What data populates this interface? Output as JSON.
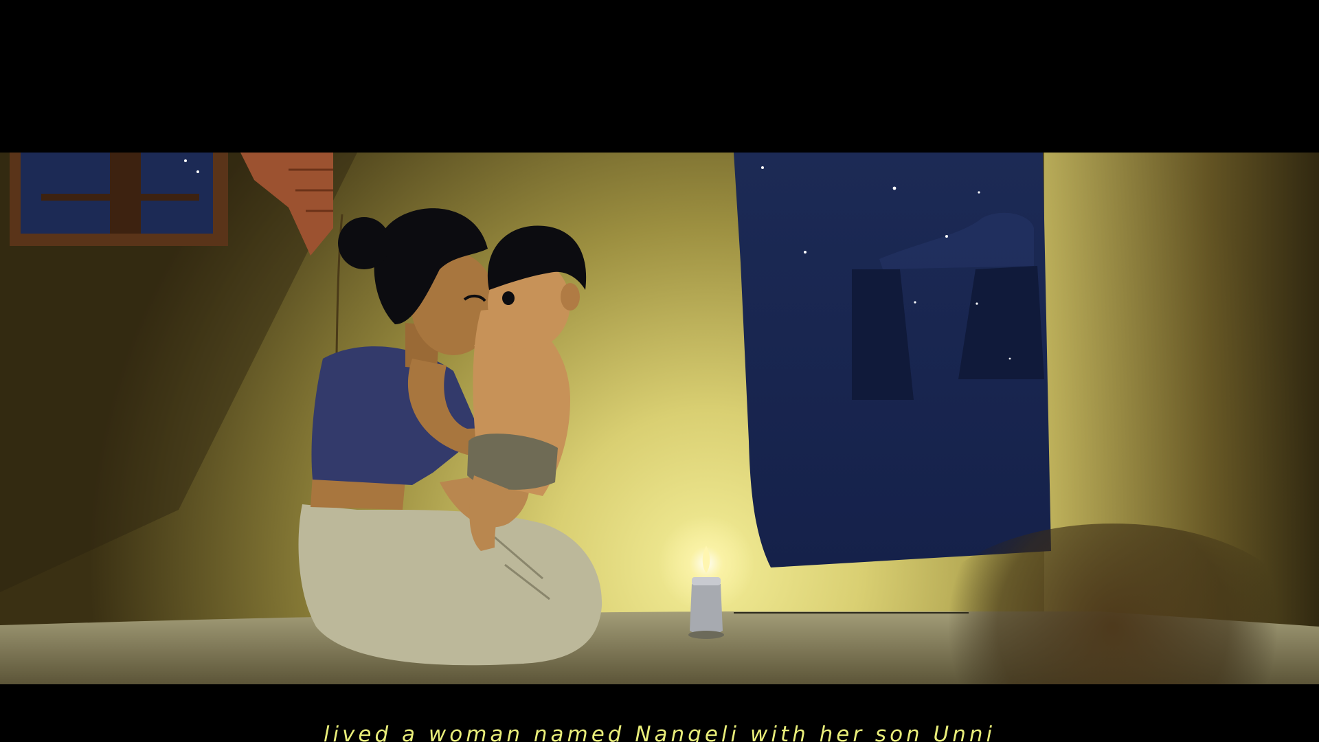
{
  "video": {
    "subtitle": "lived a woman named Nangeli with her son Unni"
  },
  "colors": {
    "letterbox": "#000000",
    "subtitle": "#e9ee7a",
    "wall_glow": "#e8e27a",
    "wall_shadow": "#3d3314",
    "night_sky": "#1c2a55",
    "floor": "#8a8466",
    "blouse": "#333a6b",
    "mundu": "#bcb89a",
    "skin": "#b9874f",
    "hair": "#0c0c10",
    "lamp_flame": "#fff6b0"
  }
}
